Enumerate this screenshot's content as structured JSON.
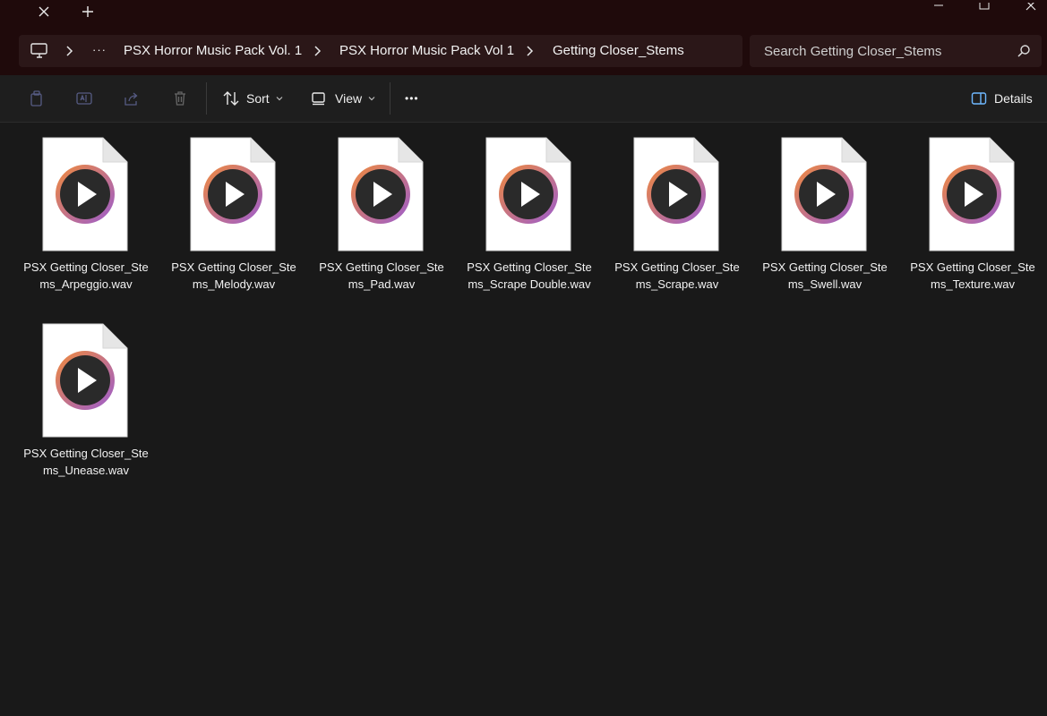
{
  "titlebar": {
    "close_tab_glyph": "✕",
    "new_tab_glyph": "+",
    "window_buttons": [
      "minimize-icon",
      "maximize-icon",
      "close-icon"
    ]
  },
  "address": {
    "crumbs": [
      "PSX Horror Music Pack Vol. 1",
      "PSX Horror Music Pack Vol 1",
      "Getting Closer_Stems"
    ],
    "overflow": "···"
  },
  "search": {
    "placeholder": "Search Getting Closer_Stems"
  },
  "toolbar": {
    "sort_label": "Sort",
    "view_label": "View",
    "more_label": "•••",
    "details_label": "Details"
  },
  "files": [
    {
      "name": "PSX Getting Closer_Stems_Arpeggio.wav"
    },
    {
      "name": "PSX Getting Closer_Stems_Melody.wav"
    },
    {
      "name": "PSX Getting Closer_Stems_Pad.wav"
    },
    {
      "name": "PSX Getting Closer_Stems_Scrape Double.wav"
    },
    {
      "name": "PSX Getting Closer_Stems_Scrape.wav"
    },
    {
      "name": "PSX Getting Closer_Stems_Swell.wav"
    },
    {
      "name": "PSX Getting Closer_Stems_Texture.wav"
    },
    {
      "name": "PSX Getting Closer_Stems_Unease.wav"
    }
  ],
  "colors": {
    "titlebar_bg": "#1f0a0b",
    "content_bg": "#191919",
    "play_ring_start": "#f08a3c",
    "play_ring_end": "#9b5ccf"
  }
}
